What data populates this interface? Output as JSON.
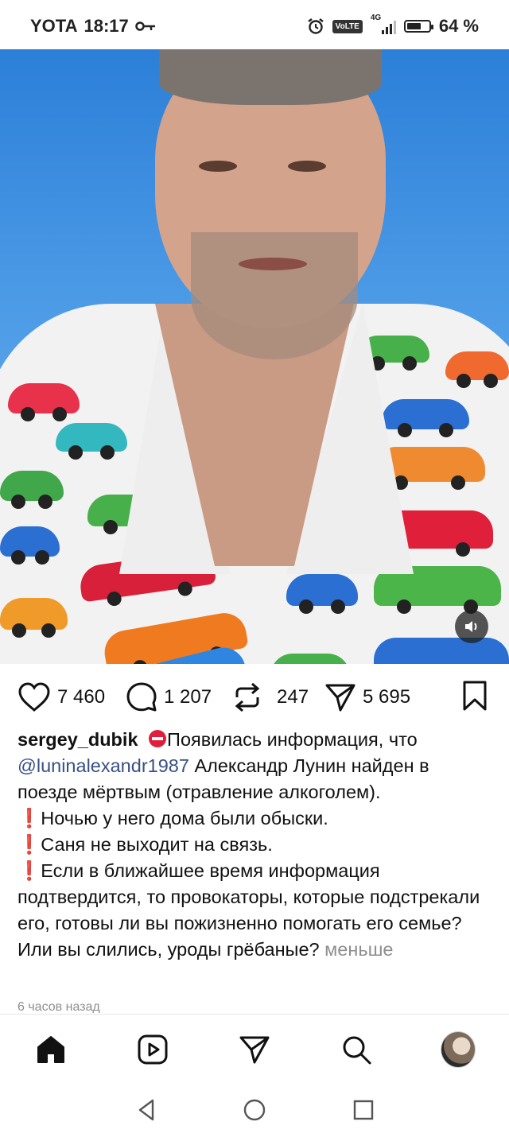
{
  "status_bar": {
    "carrier": "YOTA",
    "time": "18:17",
    "network_badge": "VoLTE",
    "network_type": "4G",
    "battery": "64 %",
    "battery_level": 0.64
  },
  "video": {
    "mute_icon": "speaker-icon"
  },
  "actions": {
    "likes": "7 460",
    "comments": "1 207",
    "reposts": "247",
    "shares": "5 695"
  },
  "caption": {
    "username": "sergey_dubik",
    "line1": "Появилась информация, что",
    "mention": "@luninalexandr1987",
    "line2": " Александр Лунин найден в поезде мёртвым (отравление алкоголем).",
    "bullet1": "Ночью у него дома были обыски.",
    "bullet2": "Саня не выходит на связь.",
    "bullet3": "Если в ближайшее время информация подтвердится, то провокаторы, которые подстрекали его, готовы ли вы пожизненно помогать его семье? Или вы слились, уроды грёбаные?",
    "less": "меньше",
    "time_ago": "6 часов назад"
  },
  "bottom_nav": {
    "items": [
      "home-icon",
      "reels-icon",
      "direct-icon",
      "search-icon",
      "profile-avatar"
    ]
  },
  "system_nav": {
    "items": [
      "back-icon",
      "home-circle-icon",
      "recents-icon"
    ]
  }
}
